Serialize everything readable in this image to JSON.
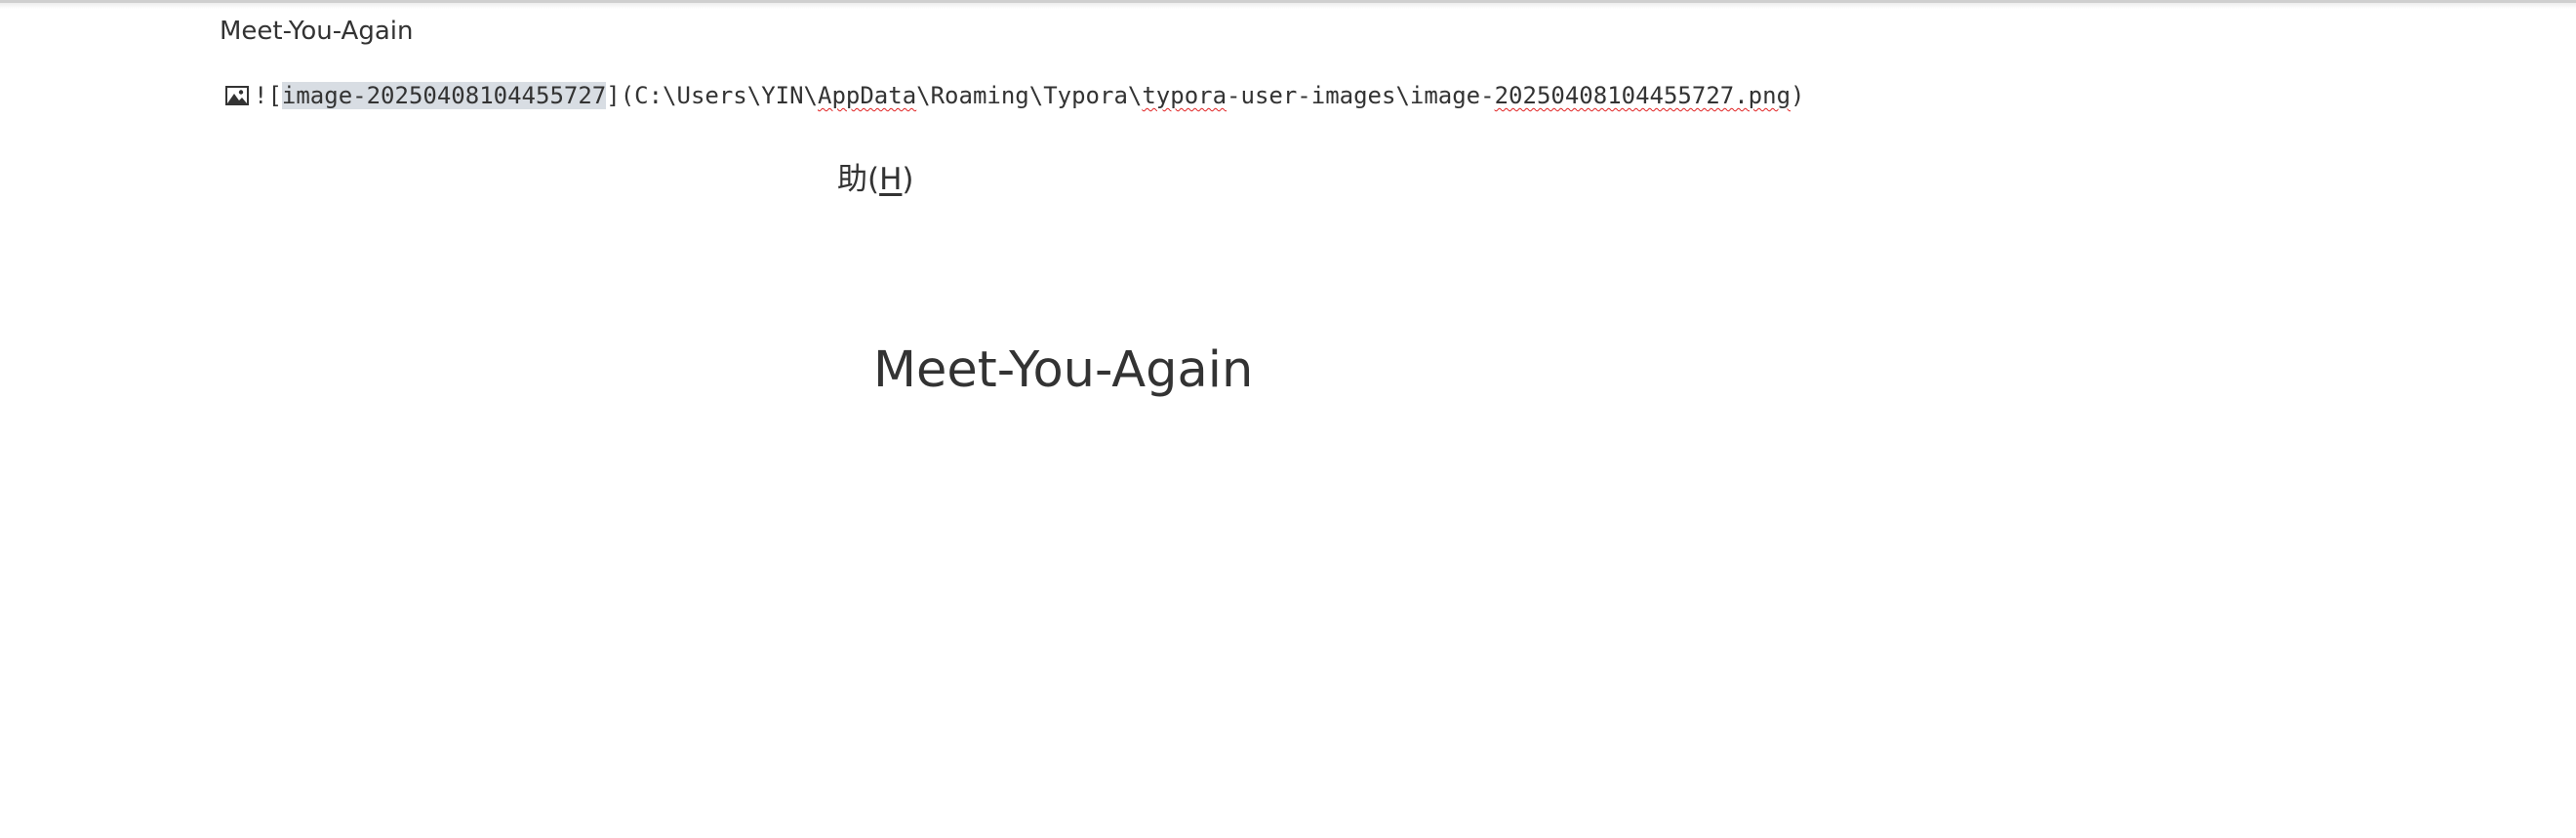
{
  "document": {
    "title": "Meet-You-Again"
  },
  "markdown_line": {
    "icon": "image-icon",
    "open_bracket": "![",
    "alt_text": "image-20250408104455727",
    "close_bracket": "](",
    "path_parts": [
      "C:\\Users\\YIN\\",
      "AppData",
      "\\Roaming\\Typora\\",
      "typora",
      "-user-images\\image-",
      "20250408104455727.png",
      ")"
    ]
  },
  "menu_fragment": {
    "prefix": "助(",
    "mnemonic": "H",
    "suffix": ")"
  },
  "heading": {
    "text": "Meet-You-Again"
  },
  "colors": {
    "text": "#333333",
    "selection": "#d8dde3",
    "spellcheck": "#e02020"
  }
}
